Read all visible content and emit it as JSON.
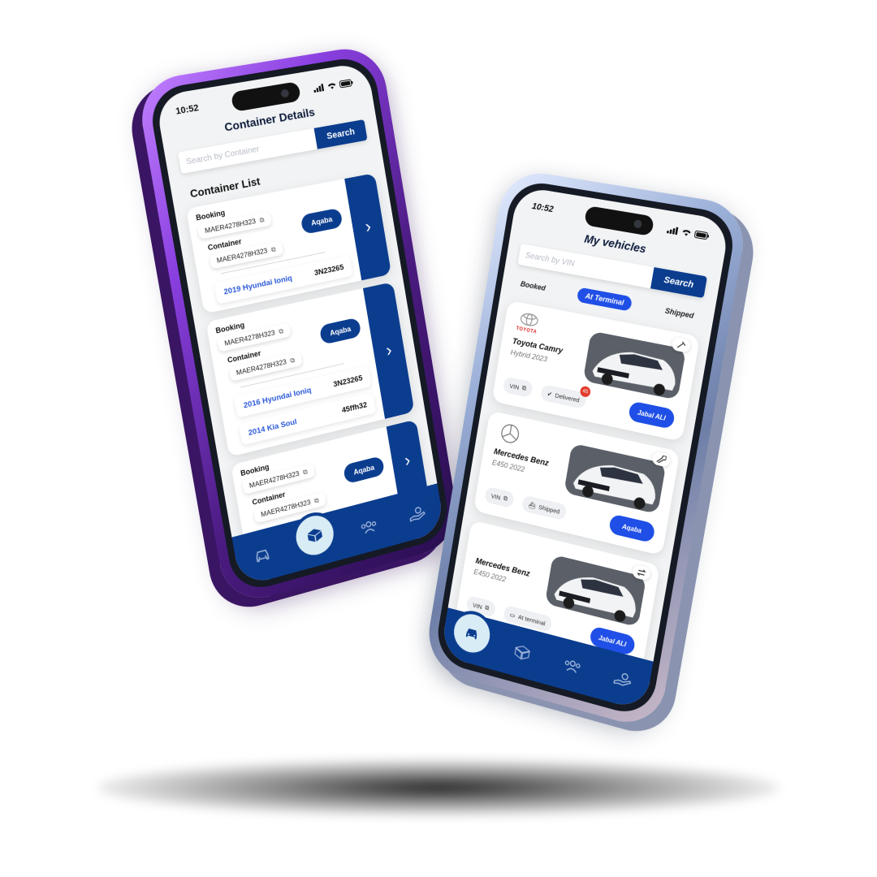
{
  "left_phone": {
    "status_time": "10:52",
    "title": "Container Details",
    "search": {
      "placeholder": "Search by Container",
      "button_label": "Search"
    },
    "section_title": "Container List",
    "containers": [
      {
        "booking_label": "Booking",
        "booking_value": "MAER4278H323",
        "container_label": "Container",
        "container_value": "MAER4278H323",
        "port": "Aqaba",
        "vehicles": [
          {
            "name": "2019 Hyundai Ioniq",
            "code": "3N23265"
          }
        ]
      },
      {
        "booking_label": "Booking",
        "booking_value": "MAER4278H323",
        "container_label": "Container",
        "container_value": "MAER4278H323",
        "port": "Aqaba",
        "vehicles": [
          {
            "name": "2016 Hyundai Ioniq",
            "code": "3N23265"
          },
          {
            "name": "2014 Kia Soul",
            "code": "45ffh32"
          }
        ]
      },
      {
        "booking_label": "Booking",
        "booking_value": "MAER4278H323",
        "container_label": "Container",
        "container_value": "MAER4278H323",
        "port": "Aqaba",
        "vehicles": []
      }
    ]
  },
  "right_phone": {
    "status_time": "10:52",
    "title": "My vehicles",
    "search": {
      "placeholder": "Search by VIN",
      "button_label": "Search"
    },
    "tabs": [
      {
        "label": "Booked",
        "active": false
      },
      {
        "label": "At Terminal",
        "active": true
      },
      {
        "label": "Shipped",
        "active": false
      }
    ],
    "vehicles": [
      {
        "brand_text": "TOYOTA",
        "name": "Toyota Camry",
        "sub": "Hybrid 2023",
        "vin_label": "VIN",
        "status_label": "Delivered",
        "status_badge": "45",
        "destination": "Jabal ALI",
        "corner_icon": "key-icon"
      },
      {
        "brand_text": "",
        "name": "Mercedes Benz",
        "sub": "E450 2022",
        "vin_label": "VIN",
        "status_label": "Shipped",
        "status_badge": "",
        "destination": "Aqaba",
        "corner_icon": "wrench-icon"
      },
      {
        "brand_text": "",
        "name": "Mercedes Benz",
        "sub": "E450 2022",
        "vin_label": "VIN",
        "status_label": "At terminal",
        "status_badge": "",
        "destination": "Jabal ALI",
        "corner_icon": "swap-icon"
      }
    ]
  },
  "bottom_nav": [
    "car-icon",
    "box-icon",
    "people-icon",
    "hand-money-icon"
  ],
  "colors": {
    "primary": "#0b3d8f",
    "accent": "#1f4fe6",
    "link": "#2b59d9",
    "badge": "#e23a2b"
  }
}
